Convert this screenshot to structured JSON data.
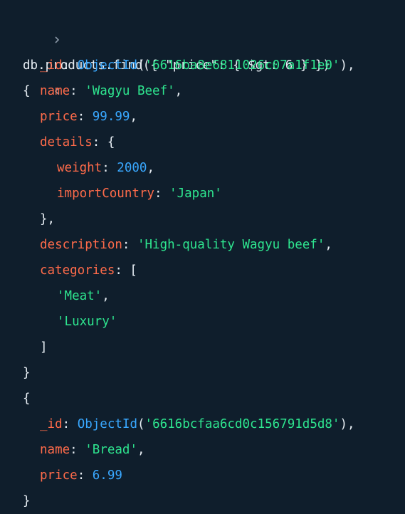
{
  "command": "db.products.find({ \"price\": { $gt: 6 } })",
  "result": {
    "docs": [
      {
        "_id_label": "_id",
        "_id_fn": "ObjectId",
        "_id_value": "'6616ba8e6811026c07a1f1e0'",
        "name_label": "name",
        "name_value": "'Wagyu Beef'",
        "price_label": "price",
        "price_value": "99.99",
        "details_label": "details",
        "weight_label": "weight",
        "weight_value": "2000",
        "importCountry_label": "importCountry",
        "importCountry_value": "'Japan'",
        "description_label": "description",
        "description_value": "'High-quality Wagyu beef'",
        "categories_label": "categories",
        "categories": [
          "'Meat'",
          "'Luxury'"
        ]
      },
      {
        "_id_label": "_id",
        "_id_fn": "ObjectId",
        "_id_value": "'6616bcfaa6cd0c156791d5d8'",
        "name_label": "name",
        "name_value": "'Bread'",
        "price_label": "price",
        "price_value": "6.99"
      }
    ]
  },
  "colors": {
    "background": "#0f1e2c",
    "key": "#ff6b4a",
    "string": "#2ee58f",
    "number": "#39a8ff",
    "text": "#e6edf3",
    "prompt": "#8a97a6"
  },
  "icons": {
    "input_prompt": "chevron-right-icon",
    "output_marker": "chevron-left-icon"
  }
}
